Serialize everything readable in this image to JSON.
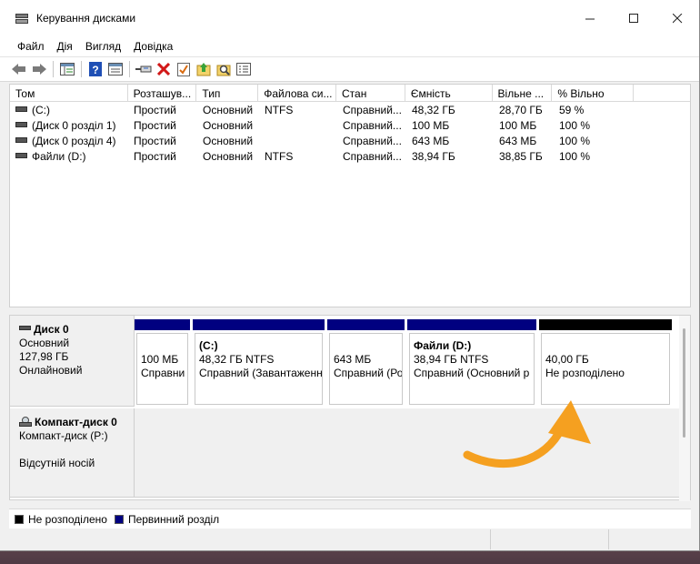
{
  "window": {
    "title": "Керування дисками"
  },
  "menu": [
    "Файл",
    "Дія",
    "Вигляд",
    "Довідка"
  ],
  "toolbar": {
    "buttons": [
      "back-icon",
      "forward-icon",
      "console-tree-icon",
      "help-icon",
      "properties-icon",
      "connect-icon",
      "delete-icon",
      "check-icon",
      "up-folder-icon",
      "search-icon",
      "list-view-icon"
    ]
  },
  "volume_table": {
    "columns": [
      "Том",
      "Розташув...",
      "Тип",
      "Файлова си...",
      "Стан",
      "Ємність",
      "Вільне ...",
      "% Вільно",
      ""
    ],
    "rows": [
      [
        "(C:)",
        "Простий",
        "Основний",
        "NTFS",
        "Справний...",
        "48,32 ГБ",
        "28,70 ГБ",
        "59 %"
      ],
      [
        "(Диск 0 розділ 1)",
        "Простий",
        "Основний",
        "",
        "Справний...",
        "100 МБ",
        "100 МБ",
        "100 %"
      ],
      [
        "(Диск 0 розділ 4)",
        "Простий",
        "Основний",
        "",
        "Справний...",
        "643 МБ",
        "643 МБ",
        "100 %"
      ],
      [
        "Файли (D:)",
        "Простий",
        "Основний",
        "NTFS",
        "Справний...",
        "38,94 ГБ",
        "38,85 ГБ",
        "100 %"
      ]
    ]
  },
  "disk0": {
    "name": "Диск 0",
    "type": "Основний",
    "size": "127,98 ГБ",
    "status": "Онлайновий",
    "partitions": [
      {
        "title": "",
        "size": "100 МБ",
        "status": "Справни",
        "bar": "primary"
      },
      {
        "title": "(C:)",
        "size": "48,32 ГБ NTFS",
        "status": "Справний (Завантаженн",
        "bar": "primary"
      },
      {
        "title": "",
        "size": "643 МБ",
        "status": "Справний (Ро",
        "bar": "primary"
      },
      {
        "title": "Файли  (D:)",
        "size": "38,94 ГБ NTFS",
        "status": "Справний (Основний р",
        "bar": "primary"
      },
      {
        "title": "",
        "size": "40,00 ГБ",
        "status": "Не розподілено",
        "bar": "unallocated"
      }
    ]
  },
  "cdrom0": {
    "name": "Компакт-диск 0",
    "type": "Компакт-диск (P:)",
    "status": "Відсутній носій"
  },
  "legend": [
    {
      "label": "Не розподілено",
      "color": "#000000"
    },
    {
      "label": "Первинний розділ",
      "color": "#000080"
    }
  ],
  "colors": {
    "primary": "#000080",
    "unallocated": "#000000",
    "annotation_arrow": "#f5a020"
  }
}
